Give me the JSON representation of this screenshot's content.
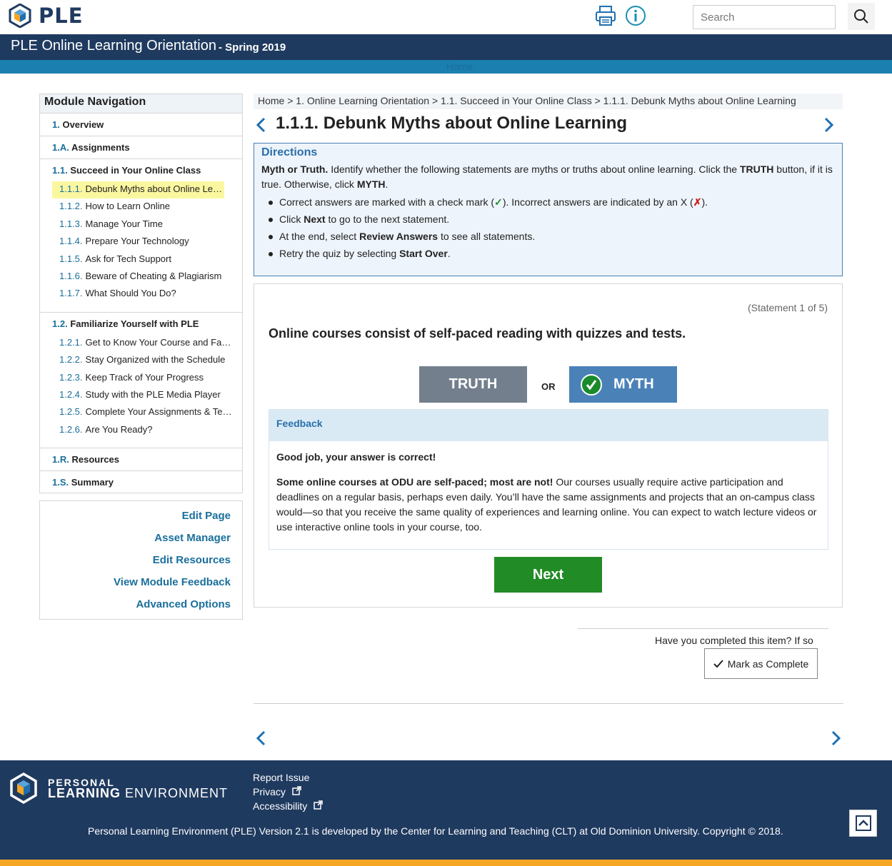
{
  "header": {
    "logo_text": "PLE",
    "search_placeholder": "Search"
  },
  "titlebar": {
    "course_title": "PLE Online Learning Orientation",
    "term": "- Spring 2019",
    "home_link": "Home"
  },
  "sidebar": {
    "title": "Module Navigation",
    "sections": [
      {
        "num": "1.",
        "label": "Overview",
        "items": []
      },
      {
        "num": "1.A.",
        "label": "Assignments",
        "items": []
      },
      {
        "num": "1.1.",
        "label": "Succeed in Your Online Class",
        "items": [
          {
            "num": "1.1.1.",
            "label": "Debunk Myths about Online Learning",
            "active": true
          },
          {
            "num": "1.1.2.",
            "label": "How to Learn Online"
          },
          {
            "num": "1.1.3.",
            "label": "Manage Your Time"
          },
          {
            "num": "1.1.4.",
            "label": "Prepare Your Technology"
          },
          {
            "num": "1.1.5.",
            "label": "Ask for Tech Support"
          },
          {
            "num": "1.1.6.",
            "label": "Beware of Cheating & Plagiarism"
          },
          {
            "num": "1.1.7.",
            "label": "What Should You Do?"
          }
        ]
      },
      {
        "num": "1.2.",
        "label": "Familiarize Yourself with PLE",
        "items": [
          {
            "num": "1.2.1.",
            "label": "Get to Know Your Course and Faculty"
          },
          {
            "num": "1.2.2.",
            "label": "Stay Organized with the Schedule"
          },
          {
            "num": "1.2.3.",
            "label": "Keep Track of Your Progress"
          },
          {
            "num": "1.2.4.",
            "label": "Study with the PLE Media Player"
          },
          {
            "num": "1.2.5.",
            "label": "Complete Your Assignments & Tests"
          },
          {
            "num": "1.2.6.",
            "label": "Are You Ready?"
          }
        ]
      },
      {
        "num": "1.R.",
        "label": "Resources",
        "items": []
      },
      {
        "num": "1.S.",
        "label": "Summary",
        "items": []
      }
    ],
    "admin_links": [
      "Edit Page",
      "Asset Manager",
      "Edit Resources",
      "View Module Feedback",
      "Advanced Options"
    ]
  },
  "breadcrumb": "Home > 1. Online Learning Orientation > 1.1. Succeed in Your Online Class > 1.1.1. Debunk Myths about Online Learning",
  "page_title": "1.1.1. Debunk Myths about Online Learning",
  "directions": {
    "title": "Directions",
    "intro_bold": "Myth or Truth.",
    "intro_text1": " Identify whether the following statements are myths or truths about online learning. Click the ",
    "truth_word": "TRUTH",
    "intro_text2": " button, if it is true. Otherwise, click ",
    "myth_word": "MYTH",
    "intro_text3": ".",
    "bullet1_a": "Correct answers are marked with a check mark (",
    "bullet1_check": "✓",
    "bullet1_b": "). Incorrect answers are indicated by an X (",
    "bullet1_x": "✗",
    "bullet1_c": ").",
    "bullet2_a": "Click ",
    "bullet2_b": "Next",
    "bullet2_c": " to go to the next statement.",
    "bullet3_a": "At the end, select ",
    "bullet3_b": "Review Answers",
    "bullet3_c": " to see all statements.",
    "bullet4_a": "Retry the quiz by selecting ",
    "bullet4_b": "Start Over",
    "bullet4_c": "."
  },
  "quiz": {
    "counter": "(Statement 1 of 5)",
    "question": "Online courses consist of self-paced reading with quizzes and tests.",
    "truth_label": "TRUTH",
    "or_label": "OR",
    "myth_label": "MYTH",
    "feedback_title": "Feedback",
    "feedback_result": "Good job, your answer is correct!",
    "feedback_bold": "Some online courses at ODU are self-paced; most are not!",
    "feedback_text": " Our courses usually require active participation and deadlines on a regular basis, perhaps even daily. You’ll have the same assignments and projects that an on-campus class would—so that you receive the same quality of experiences and learning online. You can expect to watch lecture videos or use interactive online tools in your course, too.",
    "next_label": "Next"
  },
  "completion": {
    "question": "Have you completed this item? If so",
    "button": "Mark as Complete"
  },
  "footer": {
    "brand_line1": "PERSONAL",
    "brand_line2a": "LEARNING",
    "brand_line2b": " ENVIRONMENT",
    "links": [
      "Report Issue",
      "Privacy",
      "Accessibility"
    ],
    "copyright": "Personal Learning Environment (PLE) Version 2.1 is developed by the Center for Learning and Teaching (CLT) at Old Dominion University. Copyright © 2018."
  },
  "colors": {
    "navy": "#1f3a5f",
    "link_blue": "#1a6f9c",
    "truth_gray": "#737f8c",
    "myth_blue": "#4a82b8",
    "next_green": "#218b26",
    "highlight": "#fbf7a0",
    "accent_orange": "#f5a623"
  },
  "icons": [
    "ple-logo-icon",
    "print-icon",
    "info-icon",
    "search-icon",
    "chevron-left-icon",
    "chevron-right-icon",
    "check-circle-icon",
    "checkmark-icon",
    "external-link-icon",
    "scroll-top-icon"
  ]
}
